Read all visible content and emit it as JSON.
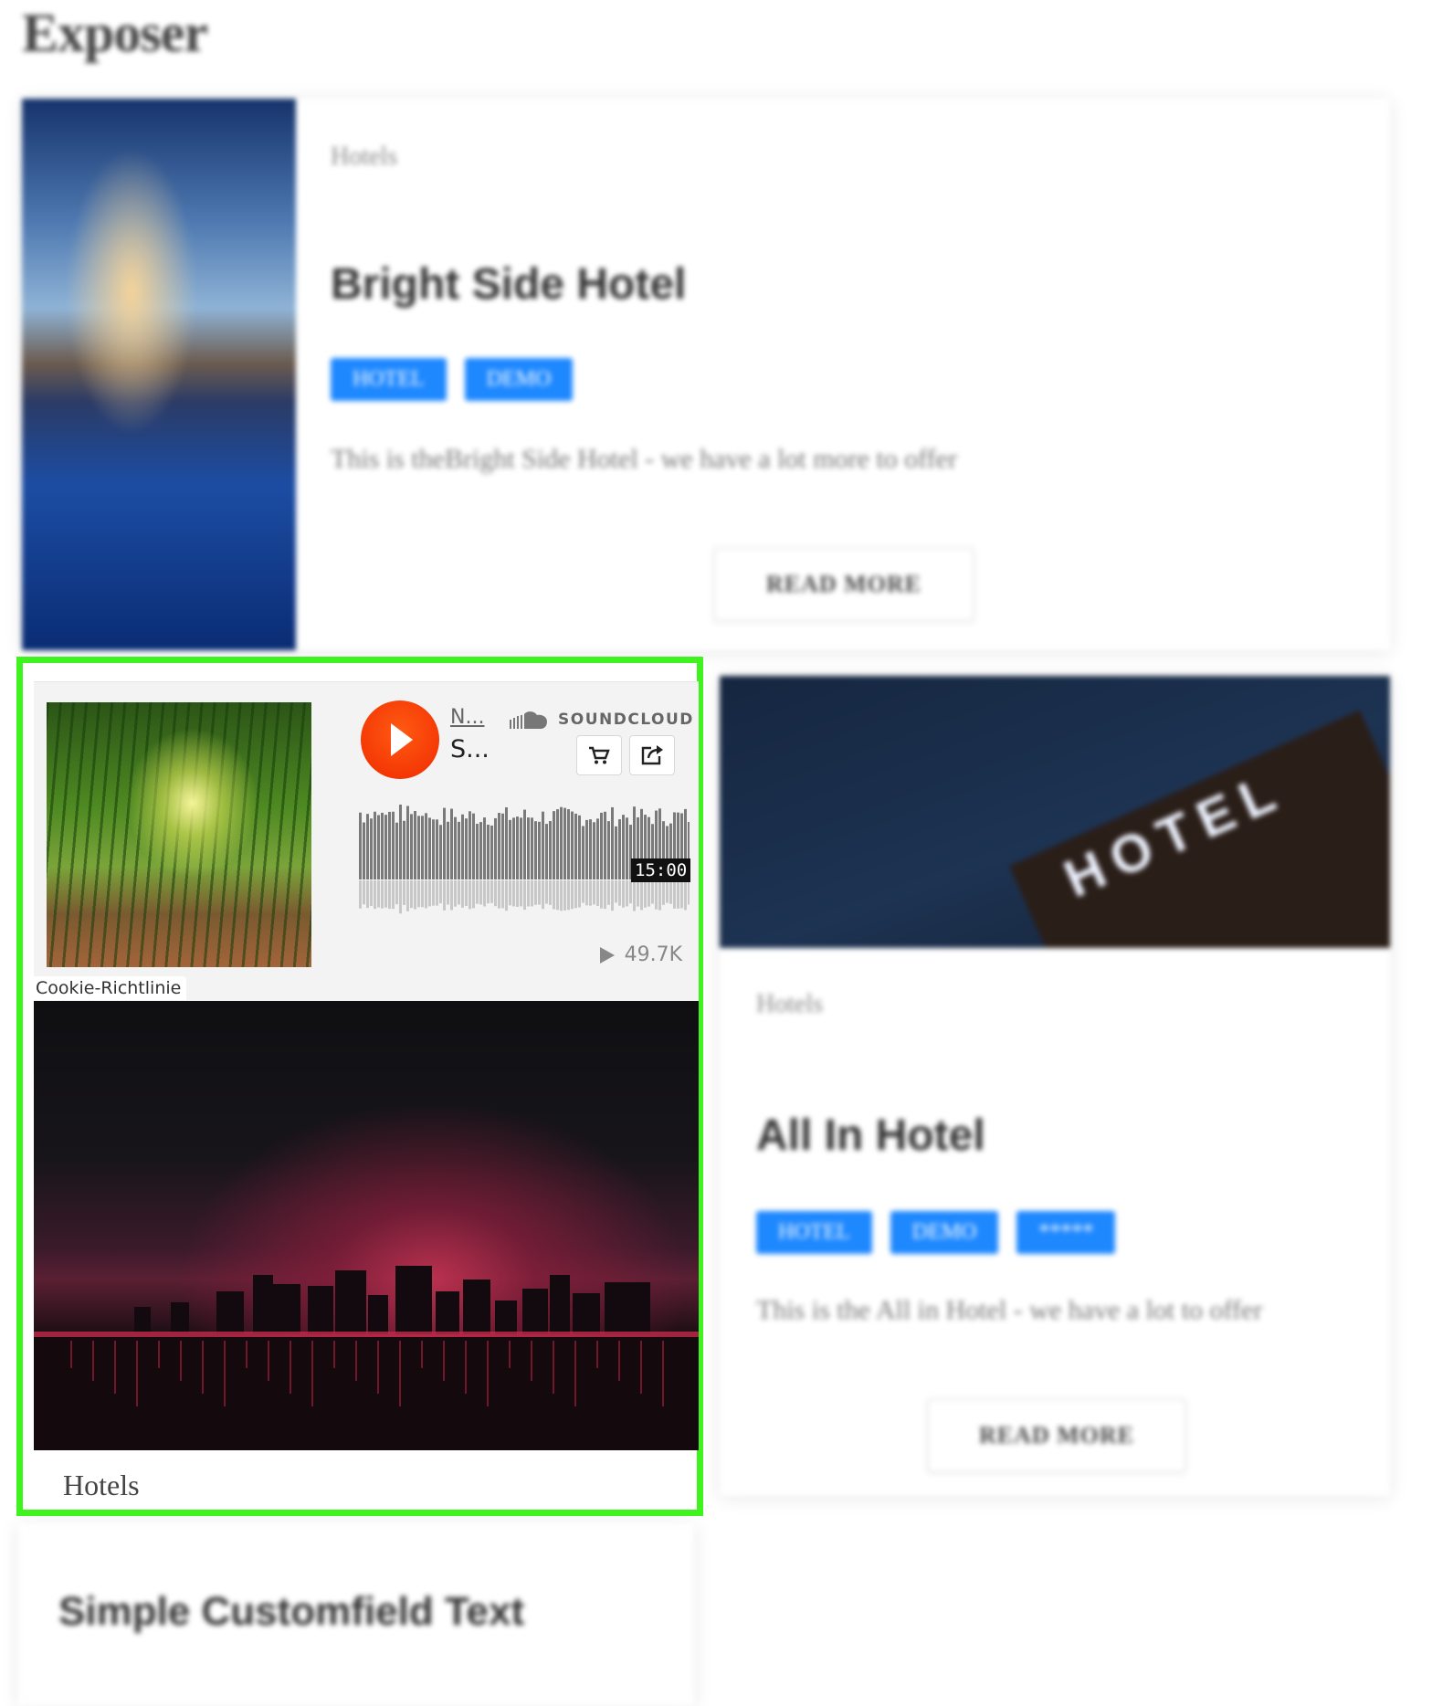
{
  "site": {
    "title": "Exposer"
  },
  "posts": [
    {
      "category": "Hotels",
      "title": "Bright Side Hotel",
      "tags": [
        "HOTEL",
        "DEMO"
      ],
      "excerpt": "This is theBright Side Hotel - we have a lot more to offer",
      "read_more": "READ MORE"
    },
    {
      "category": "Hotels",
      "title": "All In Hotel",
      "image_text": "HOTEL",
      "tags": [
        "HOTEL",
        "DEMO",
        "*****"
      ],
      "excerpt": "This is the All in Hotel - we have a lot to offer",
      "read_more": "READ MORE"
    },
    {
      "title": "Simple Customfield Text"
    }
  ],
  "soundcloud": {
    "artist": "N...",
    "track": "S...",
    "brand": "SOUNDCLOUD",
    "duration": "15:00",
    "plays": "49.7K",
    "cookie_notice": "Cookie-Richtlinie",
    "icons": {
      "play": "play-icon",
      "buy": "cart-icon",
      "share": "share-icon",
      "logo": "soundcloud-logo-icon",
      "plays": "play-count-icon"
    }
  },
  "highlighted_post": {
    "category": "Hotels"
  },
  "colors": {
    "highlight_border": "#3ff41e",
    "tag_blue": "#1e88ff",
    "soundcloud_orange": "#ff5500"
  }
}
